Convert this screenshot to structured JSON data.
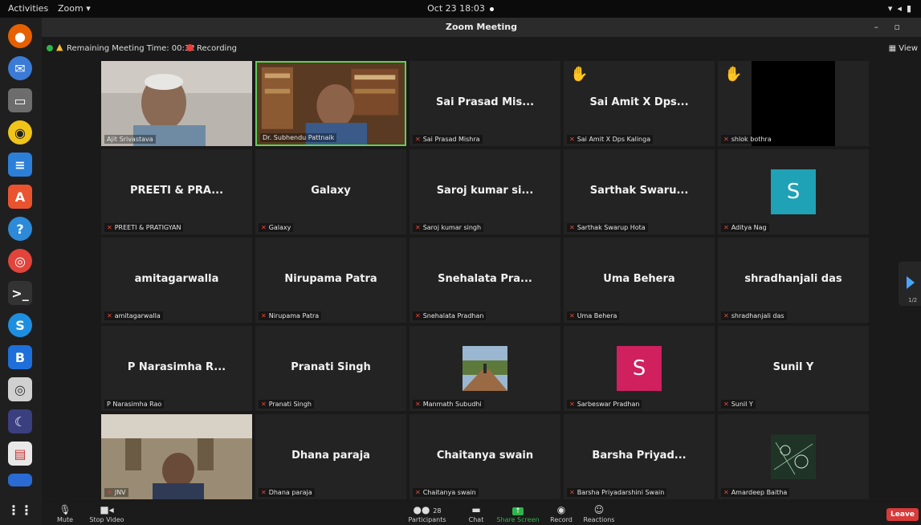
{
  "system": {
    "activities": "Activities",
    "app_menu": "Zoom ▾",
    "clock": "Oct 23  18:03",
    "tray_icons": [
      "wifi-icon",
      "volume-icon",
      "battery-icon"
    ]
  },
  "window": {
    "title": "Zoom Meeting",
    "controls": "–  ▫"
  },
  "status": {
    "remaining": "Remaining Meeting Time: 00:32",
    "recording": "Recording",
    "view": "▦ View"
  },
  "colors": {
    "active_speaker": "#5fcf5a",
    "recording": "#e5403a",
    "leave": "#d93a3a",
    "share": "#2fb34a",
    "avatar_teal": "#1fa1b6",
    "avatar_magenta": "#d0205e"
  },
  "tiles": [
    {
      "label": "Ajit Srivastava",
      "center": "",
      "muted": false,
      "hand": false,
      "kind": "video1"
    },
    {
      "label": "Dr. Subhendu Pattnaik",
      "center": "",
      "muted": false,
      "hand": false,
      "kind": "video2",
      "active": true
    },
    {
      "label": "Sai Prasad Mishra",
      "center": "Sai Prasad Mis...",
      "muted": true,
      "hand": false,
      "kind": "name"
    },
    {
      "label": "Sai Amit X Dps Kalinga",
      "center": "Sai Amit X Dps...",
      "muted": true,
      "hand": true,
      "kind": "name"
    },
    {
      "label": "shlok bothra",
      "center": "",
      "muted": true,
      "hand": true,
      "kind": "black"
    },
    {
      "label": "PREETI & PRATIGYAN",
      "center": "PREETI & PRA...",
      "muted": true,
      "hand": false,
      "kind": "name"
    },
    {
      "label": "Galaxy",
      "center": "Galaxy",
      "muted": true,
      "hand": false,
      "kind": "name"
    },
    {
      "label": "Saroj kumar singh",
      "center": "Saroj kumar si...",
      "muted": true,
      "hand": false,
      "kind": "name"
    },
    {
      "label": "Sarthak Swarup Hota",
      "center": "Sarthak Swaru...",
      "muted": true,
      "hand": false,
      "kind": "name"
    },
    {
      "label": "Aditya Nag",
      "center": "",
      "muted": true,
      "hand": false,
      "kind": "avatar",
      "avatar_letter": "S",
      "avatar_color": "#1fa1b6"
    },
    {
      "label": "amitagarwalla",
      "center": "amitagarwalla",
      "muted": true,
      "hand": false,
      "kind": "name"
    },
    {
      "label": "Nirupama Patra",
      "center": "Nirupama Patra",
      "muted": true,
      "hand": false,
      "kind": "name"
    },
    {
      "label": "Snehalata Pradhan",
      "center": "Snehalata Pra...",
      "muted": true,
      "hand": false,
      "kind": "name"
    },
    {
      "label": "Uma Behera",
      "center": "Uma Behera",
      "muted": true,
      "hand": false,
      "kind": "name"
    },
    {
      "label": "shradhanjali das",
      "center": "shradhanjali das",
      "muted": true,
      "hand": false,
      "kind": "name"
    },
    {
      "label": "P Narasimha Rao",
      "center": "P Narasimha R...",
      "muted": false,
      "hand": false,
      "kind": "name"
    },
    {
      "label": "Pranati Singh",
      "center": "Pranati Singh",
      "muted": true,
      "hand": false,
      "kind": "name"
    },
    {
      "label": "Manmath Subudhi",
      "center": "",
      "muted": true,
      "hand": false,
      "kind": "photo"
    },
    {
      "label": "Sarbeswar Pradhan",
      "center": "",
      "muted": true,
      "hand": false,
      "kind": "avatar",
      "avatar_letter": "S",
      "avatar_color": "#d0205e"
    },
    {
      "label": "Sunil Y",
      "center": "Sunil Y",
      "muted": true,
      "hand": false,
      "kind": "name"
    },
    {
      "label": "JNV",
      "center": "",
      "muted": true,
      "hand": false,
      "kind": "video3"
    },
    {
      "label": "Dhana paraja",
      "center": "Dhana paraja",
      "muted": true,
      "hand": false,
      "kind": "name"
    },
    {
      "label": "Chaitanya swain",
      "center": "Chaitanya swain",
      "muted": true,
      "hand": false,
      "kind": "name"
    },
    {
      "label": "Barsha Priyadarshini Swain",
      "center": "Barsha Priyad...",
      "muted": true,
      "hand": false,
      "kind": "name"
    },
    {
      "label": "Amardeep Baitha",
      "center": "",
      "muted": true,
      "hand": false,
      "kind": "pattern"
    }
  ],
  "pagination": {
    "page": "1/2"
  },
  "toolbar": {
    "mute": "Mute",
    "stop_video": "Stop Video",
    "participants": "Participants",
    "participants_count": "28",
    "chat": "Chat",
    "share": "Share Screen",
    "record": "Record",
    "reactions": "Reactions",
    "leave": "Leave"
  }
}
